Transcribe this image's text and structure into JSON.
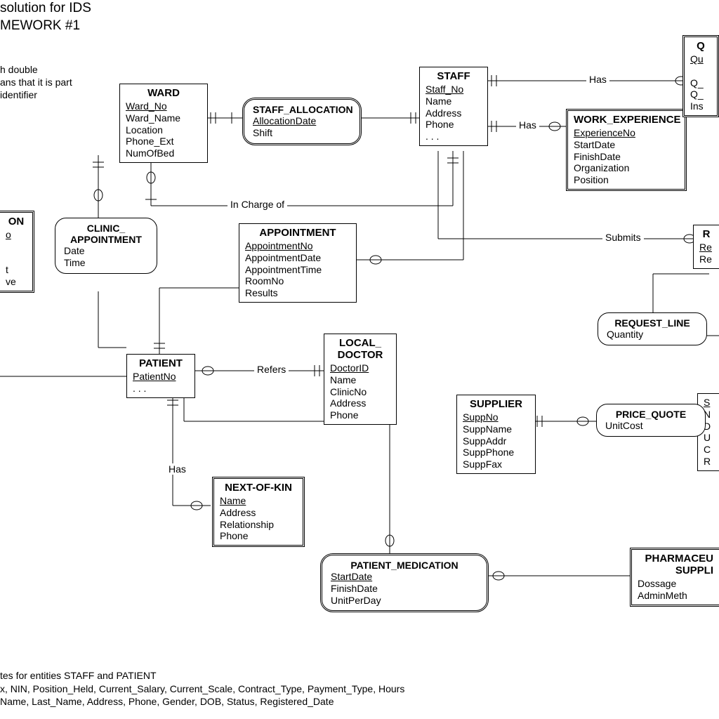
{
  "header": {
    "line1": "solution for IDS",
    "line2": "MEWORK #1"
  },
  "note_top": {
    "l1": "h double",
    "l2": "ans that it is part",
    "l3": "identifier"
  },
  "footer": {
    "l1": "tes for entities STAFF and PATIENT",
    "l2": "x, NIN, Position_Held, Current_Salary, Current_Scale, Contract_Type, Payment_Type, Hours",
    "l3": "Name, Last_Name, Address, Phone, Gender, DOB, Status, Registered_Date"
  },
  "entities": {
    "ward": {
      "title": "WARD",
      "attrs": [
        "Ward_No",
        "Ward_Name",
        "Location",
        "Phone_Ext",
        "NumOfBed"
      ],
      "keys": [
        "Ward_No"
      ]
    },
    "staff": {
      "title": "STAFF",
      "attrs": [
        "Staff_No",
        "Name",
        "Address",
        "Phone",
        ". . ."
      ],
      "keys": [
        "Staff_No"
      ]
    },
    "work_exp": {
      "title": "WORK_EXPERIENCE",
      "attrs": [
        "ExperienceNo",
        "StartDate",
        "FinishDate",
        "Organization",
        "Position"
      ],
      "keys": [
        "ExperienceNo"
      ]
    },
    "q": {
      "title": "Q",
      "attrs": [
        "Qu",
        "",
        "Q_",
        "Q_",
        "Ins"
      ],
      "keys": [
        "Qu"
      ]
    },
    "ion": {
      "title": "ON",
      "attrs": [
        "o",
        "",
        "",
        "t",
        "ve"
      ],
      "keys": [
        "o"
      ]
    },
    "appointment": {
      "title": "APPOINTMENT",
      "attrs": [
        "AppointmentNo",
        "AppointmentDate",
        "AppointmentTime",
        "RoomNo",
        "Results"
      ],
      "keys": [
        "AppointmentNo"
      ]
    },
    "patient": {
      "title": "PATIENT",
      "attrs": [
        "PatientNo",
        ". . ."
      ],
      "keys": [
        "PatientNo"
      ]
    },
    "local_doctor": {
      "title": "LOCAL_\nDOCTOR",
      "attrs": [
        "DoctorID",
        "Name",
        "ClinicNo",
        "Address",
        "Phone"
      ],
      "keys": [
        "DoctorID"
      ]
    },
    "supplier": {
      "title": "SUPPLIER",
      "attrs": [
        "SuppNo",
        "SuppName",
        "SuppAddr",
        "SuppPhone",
        "SuppFax"
      ],
      "keys": [
        "SuppNo"
      ]
    },
    "next_of_kin": {
      "title": "NEXT-OF-KIN",
      "attrs": [
        "Name",
        "Address",
        "Relationship",
        "Phone"
      ],
      "keys": [
        "Name"
      ]
    },
    "r": {
      "title": "R",
      "attrs": [
        "Re",
        "Re"
      ],
      "keys": [
        "Re"
      ]
    },
    "s": {
      "title": "",
      "attrs": [
        "S",
        "N",
        "D",
        "U",
        "C",
        "R"
      ],
      "keys": [
        "S"
      ]
    },
    "pharm": {
      "title": "PHARMACEU\nSUPPLI",
      "attrs": [
        "Dossage",
        "AdminMeth"
      ],
      "keys": []
    }
  },
  "relationships": {
    "staff_allocation": {
      "title": "STAFF_ALLOCATION",
      "attrs": [
        "AllocationDate",
        "Shift"
      ],
      "keys": [
        "AllocationDate"
      ]
    },
    "clinic_appt": {
      "title": "CLINIC_\nAPPOINTMENT",
      "attrs": [
        "Date",
        "Time"
      ],
      "keys": []
    },
    "request_line": {
      "title": "REQUEST_LINE",
      "attrs": [
        "Quantity"
      ],
      "keys": []
    },
    "price_quote": {
      "title": "PRICE_QUOTE",
      "attrs": [
        "UnitCost"
      ],
      "keys": []
    },
    "patient_med": {
      "title": "PATIENT_MEDICATION",
      "attrs": [
        "StartDate",
        "FinishDate",
        "UnitPerDay"
      ],
      "keys": [
        "StartDate"
      ]
    }
  },
  "labels": {
    "has1": "Has",
    "has2": "Has",
    "has3": "Has",
    "in_charge": "In Charge of",
    "submits": "Submits",
    "refers": "Refers"
  }
}
